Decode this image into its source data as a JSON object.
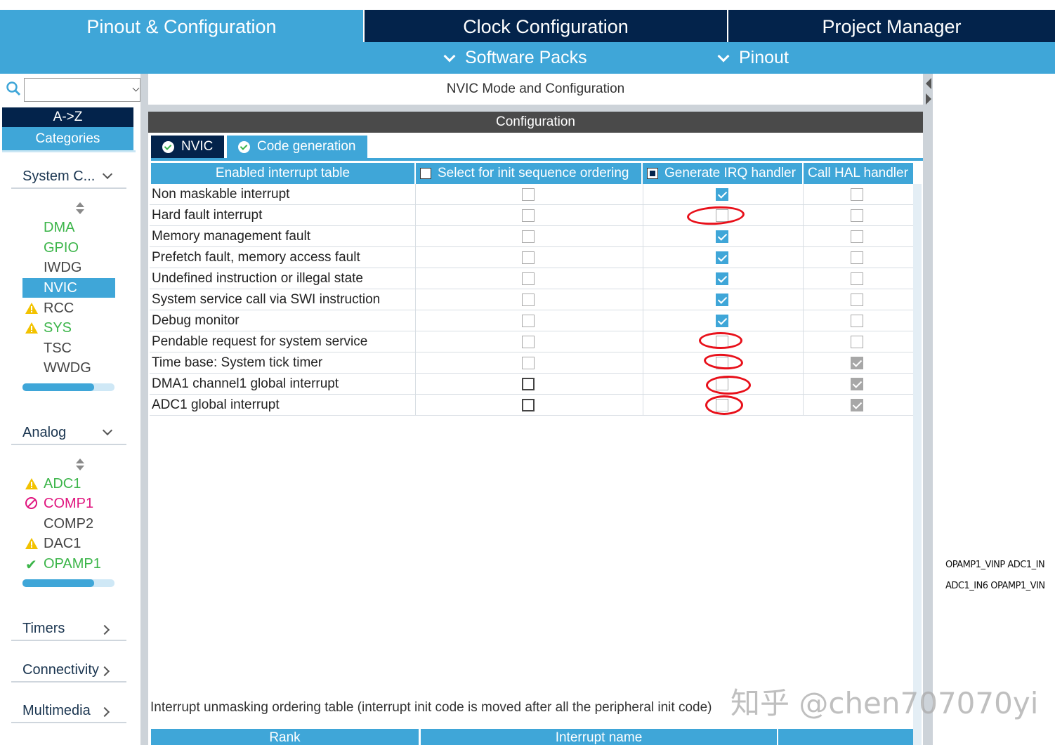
{
  "top_tabs": [
    {
      "label": "Pinout & Configuration",
      "active": true
    },
    {
      "label": "Clock Configuration",
      "active": false
    },
    {
      "label": "Project Manager",
      "active": false
    }
  ],
  "sub_menu": [
    {
      "label": "Software Packs"
    },
    {
      "label": "Pinout"
    }
  ],
  "sidebar": {
    "search": {
      "value": "",
      "placeholder": ""
    },
    "sort_az": "A->Z",
    "categories": "Categories",
    "groups": {
      "system_core": {
        "label": "System C...",
        "items": [
          {
            "label": "DMA",
            "status": "green"
          },
          {
            "label": "GPIO",
            "status": "green"
          },
          {
            "label": "IWDG",
            "status": "none"
          },
          {
            "label": "NVIC",
            "status": "selected"
          },
          {
            "label": "RCC",
            "status": "warning"
          },
          {
            "label": "SYS",
            "status": "warning"
          },
          {
            "label": "TSC",
            "status": "none"
          },
          {
            "label": "WWDG",
            "status": "none"
          }
        ]
      },
      "analog": {
        "label": "Analog",
        "items": [
          {
            "label": "ADC1",
            "status": "warning"
          },
          {
            "label": "COMP1",
            "status": "disabled"
          },
          {
            "label": "COMP2",
            "status": "none"
          },
          {
            "label": "DAC1",
            "status": "warning"
          },
          {
            "label": "OPAMP1",
            "status": "ok"
          }
        ]
      },
      "timers": {
        "label": "Timers"
      },
      "connectivity": {
        "label": "Connectivity"
      },
      "multimedia": {
        "label": "Multimedia"
      }
    }
  },
  "panel": {
    "mode_title": "NVIC Mode and Configuration",
    "config_title": "Configuration",
    "tabs": [
      {
        "label": "NVIC"
      },
      {
        "label": "Code generation"
      }
    ],
    "table": {
      "headers": {
        "name": "Enabled interrupt table",
        "init_seq": "Select for init sequence ordering",
        "gen_irq": "Generate IRQ handler",
        "call_hal": "Call HAL handler"
      },
      "rows": [
        {
          "name": "Non maskable interrupt",
          "init_seq": false,
          "gen_irq": true,
          "call_hal": false
        },
        {
          "name": "Hard fault interrupt",
          "init_seq": false,
          "gen_irq": false,
          "call_hal": false
        },
        {
          "name": "Memory management fault",
          "init_seq": false,
          "gen_irq": true,
          "call_hal": false
        },
        {
          "name": "Prefetch fault, memory access fault",
          "init_seq": false,
          "gen_irq": true,
          "call_hal": false
        },
        {
          "name": "Undefined instruction or illegal state",
          "init_seq": false,
          "gen_irq": true,
          "call_hal": false
        },
        {
          "name": "System service call via SWI instruction",
          "init_seq": false,
          "gen_irq": true,
          "call_hal": false
        },
        {
          "name": "Debug monitor",
          "init_seq": false,
          "gen_irq": true,
          "call_hal": false
        },
        {
          "name": "Pendable request for system service",
          "init_seq": false,
          "gen_irq": false,
          "call_hal": false
        },
        {
          "name": "Time base: System tick timer",
          "init_seq": false,
          "gen_irq": false,
          "call_hal": true
        },
        {
          "name": "DMA1 channel1 global interrupt",
          "init_seq": false,
          "gen_irq": false,
          "call_hal": true
        },
        {
          "name": "ADC1 global interrupt",
          "init_seq": false,
          "gen_irq": false,
          "call_hal": true
        }
      ]
    },
    "unmask_label": "Interrupt unmasking ordering table (interrupt init code is moved after all the peripheral init code)",
    "rank_headers": {
      "rank": "Rank",
      "interrupt_name": "Interrupt name",
      "extra": ""
    }
  },
  "pin_labels": [
    "OPAMP1_VINP ADC1_IN",
    "ADC1_IN6 OPAMP1_VIN"
  ],
  "watermark": "知乎 @chen707070yi",
  "colors": {
    "accent": "#3fa6d8",
    "navy": "#03234b",
    "annotation": "#e8101a"
  }
}
